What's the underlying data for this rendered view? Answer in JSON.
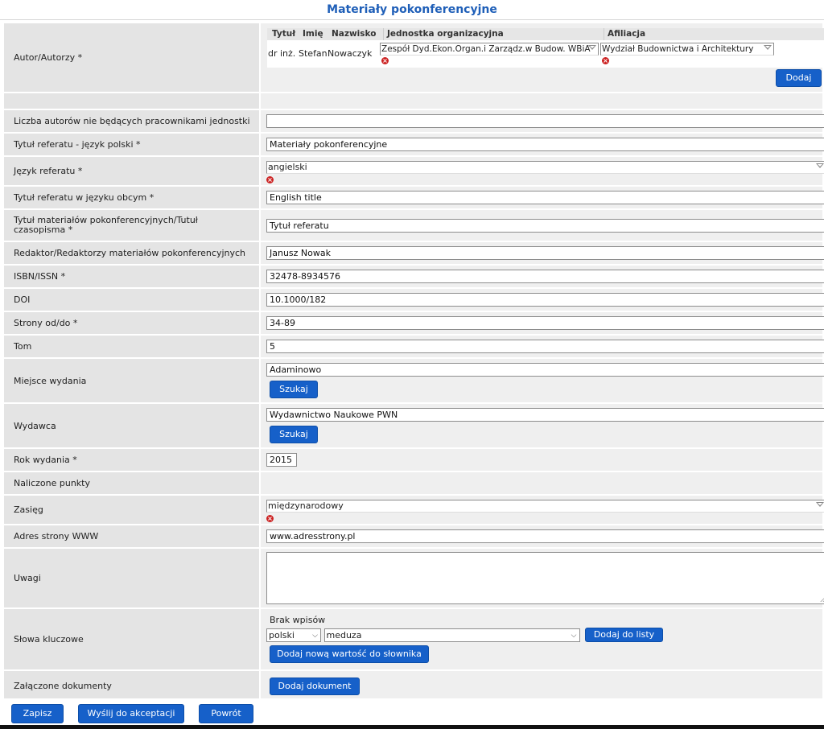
{
  "page_title": "Materiały pokonferencyjne",
  "authors": {
    "label": "Autor/Autorzy *",
    "columns": [
      "Tytuł",
      "Imię",
      "Nazwisko",
      "Jednostka organizacyjna",
      "Afiliacja"
    ],
    "row": {
      "title": "dr inż.",
      "first_name": "Stefan",
      "last_name": "Nowaczyk",
      "unit": "Zespół Dyd.Ekon.Organ.i Zarządz.w Budow. WBiA",
      "affiliation": "Wydział Budownictwa i Architektury"
    },
    "add_button": "Dodaj"
  },
  "fields": {
    "non_staff_count": {
      "label": "Liczba autorów nie będących pracownikami jednostki",
      "value": ""
    },
    "title_pl": {
      "label": "Tytuł referatu - język polski *",
      "value": "Materiały pokonferencyjne"
    },
    "language": {
      "label": "Język referatu *",
      "value": "angielski"
    },
    "title_foreign": {
      "label": "Tytuł referatu w języku obcym *",
      "value": "English title"
    },
    "proceedings_title": {
      "label": "Tytuł materiałów pokonferencyjnych/Tutuł czasopisma *",
      "value": "Tytuł referatu"
    },
    "editors": {
      "label": "Redaktor/Redaktorzy materiałów pokonferencyjnych",
      "value": "Janusz Nowak"
    },
    "isbn": {
      "label": "ISBN/ISSN *",
      "value": "32478-8934576"
    },
    "doi": {
      "label": "DOI",
      "value": "10.1000/182"
    },
    "pages": {
      "label": "Strony od/do *",
      "value": "34-89"
    },
    "volume": {
      "label": "Tom",
      "value": "5"
    },
    "place": {
      "label": "Miejsce wydania",
      "value": "Adaminowo",
      "button": "Szukaj"
    },
    "publisher": {
      "label": "Wydawca",
      "value": "Wydawnictwo Naukowe PWN",
      "button": "Szukaj"
    },
    "year": {
      "label": "Rok wydania *",
      "value": "2015"
    },
    "points": {
      "label": "Naliczone punkty",
      "value": ""
    },
    "scope": {
      "label": "Zasięg",
      "value": "międzynarodowy"
    },
    "www": {
      "label": "Adres strony WWW",
      "value": "www.adresstrony.pl"
    },
    "notes": {
      "label": "Uwagi",
      "value": ""
    },
    "keywords": {
      "label": "Słowa kluczowe",
      "empty_text": "Brak wpisów",
      "lang_value": "polski",
      "word_value": "meduza",
      "add_to_list": "Dodaj do listy",
      "add_dict_value": "Dodaj nową wartość do słownika"
    },
    "attachments": {
      "label": "Załączone dokumenty",
      "button": "Dodaj dokument"
    }
  },
  "actions": {
    "save": "Zapisz",
    "submit": "Wyślij do akceptacji",
    "back": "Powrót"
  }
}
